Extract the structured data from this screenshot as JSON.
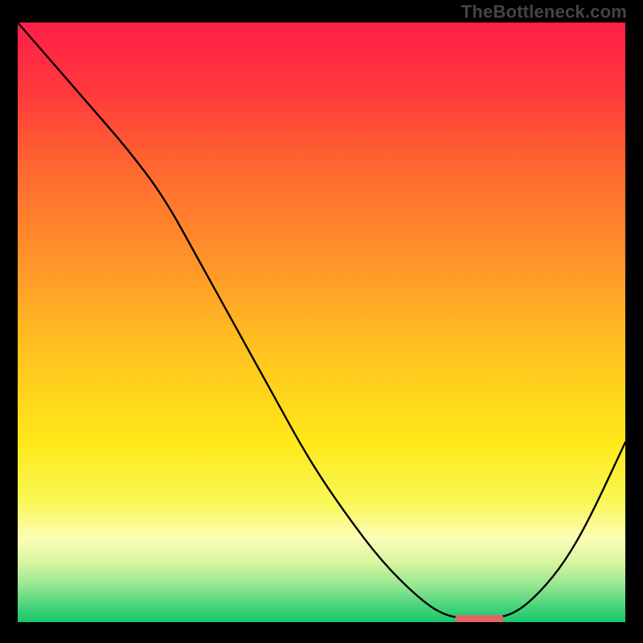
{
  "watermark": "TheBottleneck.com",
  "chart_data": {
    "type": "line",
    "title": "",
    "xlabel": "",
    "ylabel": "",
    "xlim": [
      0,
      100
    ],
    "ylim": [
      0,
      100
    ],
    "legend": false,
    "grid": false,
    "annotations": [],
    "series": [
      {
        "name": "curve",
        "x": [
          0,
          6,
          12,
          18,
          24,
          30,
          36,
          42,
          48,
          54,
          60,
          66,
          70,
          74,
          78,
          82,
          86,
          90,
          94,
          100
        ],
        "y": [
          100,
          93,
          86,
          79,
          71,
          60,
          49,
          38,
          27,
          18,
          10,
          4,
          1.2,
          0.5,
          0.5,
          1.5,
          5,
          10,
          17,
          30
        ]
      }
    ],
    "marker": {
      "x_start": 72,
      "x_end": 80,
      "y": 0.5
    },
    "background_gradient": {
      "stops": [
        {
          "pct": 0,
          "color": "#ff1f47"
        },
        {
          "pct": 12,
          "color": "#ff3a3d"
        },
        {
          "pct": 25,
          "color": "#ff6a2f"
        },
        {
          "pct": 40,
          "color": "#ff942a"
        },
        {
          "pct": 55,
          "color": "#ffc31f"
        },
        {
          "pct": 70,
          "color": "#ffe81a"
        },
        {
          "pct": 80,
          "color": "#f8f756"
        },
        {
          "pct": 86,
          "color": "#fdfdb7"
        },
        {
          "pct": 90,
          "color": "#d8f5a0"
        },
        {
          "pct": 94,
          "color": "#93e691"
        },
        {
          "pct": 97,
          "color": "#4fd67e"
        },
        {
          "pct": 100,
          "color": "#17c66c"
        }
      ]
    }
  }
}
